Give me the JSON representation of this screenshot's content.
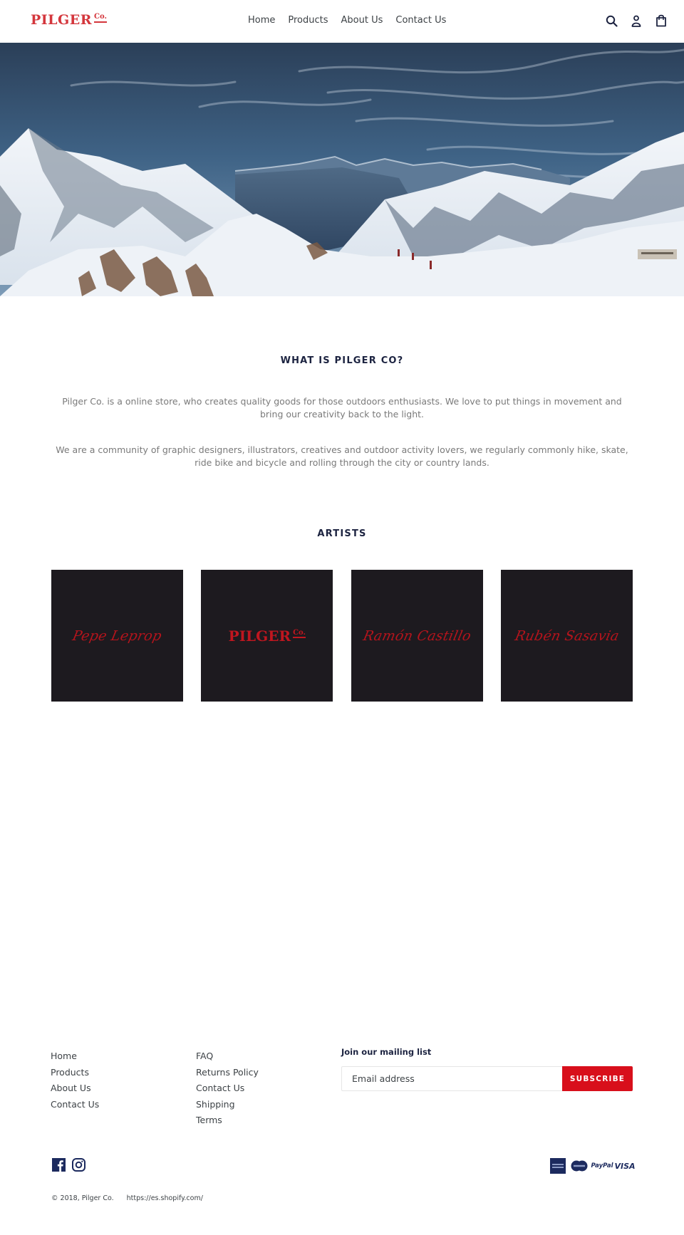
{
  "header": {
    "logo": {
      "main": "PILGER",
      "co": "Co."
    },
    "nav": [
      {
        "label": "Home"
      },
      {
        "label": "Products"
      },
      {
        "label": "About Us"
      },
      {
        "label": "Contact Us"
      }
    ],
    "icons": [
      "search-icon",
      "account-icon",
      "cart-icon"
    ]
  },
  "hero": {
    "image": "snowy-mountain-landscape"
  },
  "about": {
    "title": "WHAT IS PILGER CO?",
    "paragraph1": "Pilger Co. is a online store, who creates quality goods for those outdoors enthusiasts. We love to put things in movement and bring our creativity back to the light.",
    "paragraph2": "We are a community of graphic designers, illustrators, creatives and outdoor activity lovers, we regularly commonly hike, skate, ride bike and bicycle and rolling through the city or country lands."
  },
  "artists": {
    "title": "ARTISTS",
    "items": [
      {
        "name": "Pepe Leprop",
        "type": "signature"
      },
      {
        "name": "PILGER",
        "co": "Co.",
        "type": "logo"
      },
      {
        "name": "Ramón Castillo",
        "type": "signature"
      },
      {
        "name": "Rubén Sasavia",
        "type": "signature"
      }
    ]
  },
  "footer": {
    "links_col1": [
      {
        "label": "Home"
      },
      {
        "label": "Products"
      },
      {
        "label": "About Us"
      },
      {
        "label": "Contact Us"
      }
    ],
    "links_col2": [
      {
        "label": "FAQ"
      },
      {
        "label": "Returns Policy"
      },
      {
        "label": "Contact Us"
      },
      {
        "label": "Shipping"
      },
      {
        "label": "Terms"
      }
    ],
    "newsletter": {
      "title": "Join our mailing list",
      "placeholder": "Email address",
      "button": "SUBSCRIBE"
    },
    "social": [
      "facebook-icon",
      "instagram-icon"
    ],
    "payments": {
      "amex": "American Express",
      "mastercard": "MasterCard",
      "paypal": "PayPal",
      "visa": "VISA"
    },
    "copyright": "© 2018, Pilger Co.",
    "powered_link": "https://es.shopify.com/"
  },
  "colors": {
    "brand_red": "#d4363c",
    "button_red": "#d80f1b",
    "heading_navy": "#1c2340",
    "artist_bg": "#1d1a1f",
    "body_text": "#7a7a7a"
  }
}
